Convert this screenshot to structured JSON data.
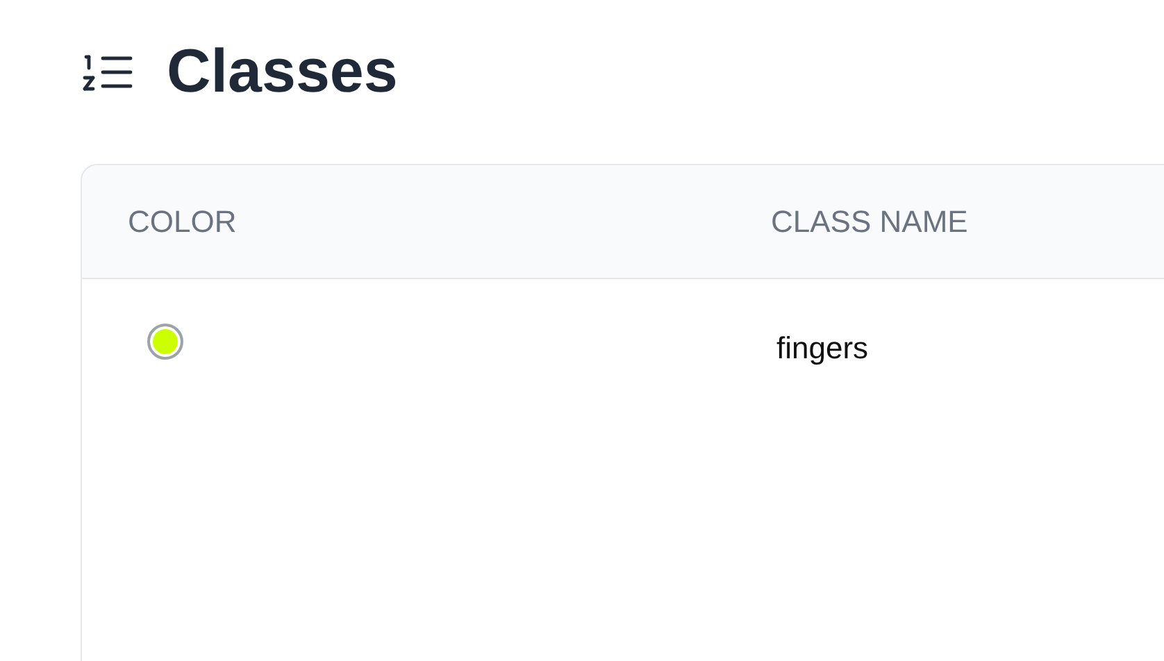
{
  "title": "Classes",
  "table": {
    "columns": [
      "COLOR",
      "CLASS NAME"
    ],
    "rows": [
      {
        "color": "#ccff00",
        "class_name": "fingers"
      }
    ]
  }
}
